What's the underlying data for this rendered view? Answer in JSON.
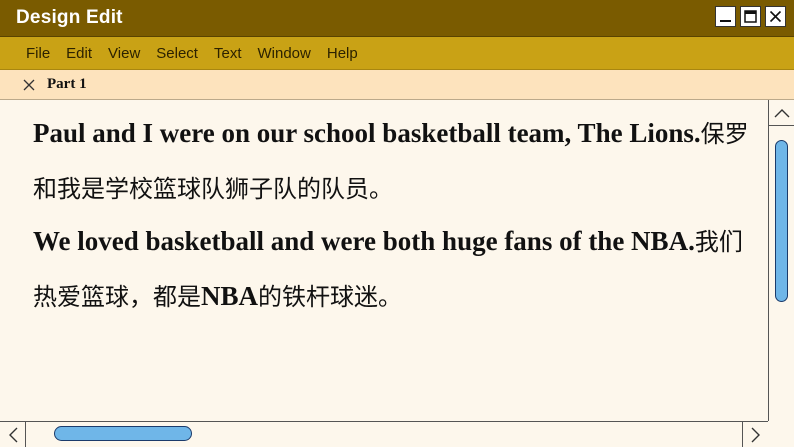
{
  "window": {
    "title": "Design Edit",
    "controls": [
      "minimize-icon",
      "maximize-icon",
      "close-icon"
    ]
  },
  "menu": {
    "items": [
      "File",
      "Edit",
      "View",
      "Select",
      "Text",
      "Window",
      "Help"
    ]
  },
  "tab": {
    "label": "Part 1",
    "close_icon": "close-icon"
  },
  "document": {
    "paragraphs": [
      {
        "english": "Paul and I were on our school basketball team, The Lions.",
        "chinese": "保罗和我是学校篮球队狮子队的队员。"
      },
      {
        "english": "We loved basketball and were both huge fans of the NBA.",
        "chinese_parts": [
          "我们热爱篮球，都是",
          "NBA",
          "的铁杆球迷。"
        ]
      }
    ]
  },
  "colors": {
    "titlebar": "#7a5b00",
    "menubar": "#c9a215",
    "tabbar": "#fde3bd",
    "page": "#fdf7ec",
    "scroll_thumb": "#6fb6e8"
  }
}
